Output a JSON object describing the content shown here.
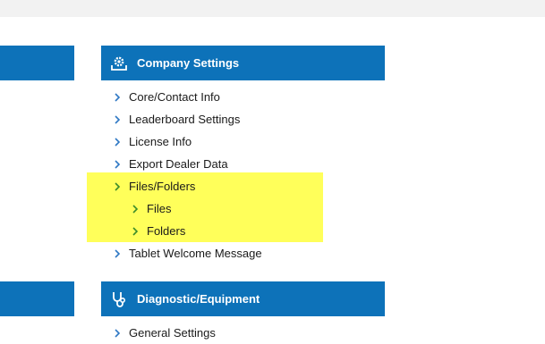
{
  "colors": {
    "header_bg": "#0d72b9",
    "highlight": "#ffff5a",
    "chevron_default": "#2f78c4",
    "chevron_highlighted": "#3c8c2a",
    "topbar": "#f2f2f2"
  },
  "company_settings": {
    "title": "Company Settings",
    "icon": "gear-upload-icon",
    "items": [
      {
        "label": "Core/Contact Info"
      },
      {
        "label": "Leaderboard Settings"
      },
      {
        "label": "License Info"
      },
      {
        "label": "Export Dealer Data"
      },
      {
        "label": "Files/Folders",
        "highlighted": true
      },
      {
        "label": "Files",
        "highlighted": true,
        "indent": true
      },
      {
        "label": "Folders",
        "highlighted": true,
        "indent": true
      },
      {
        "label": "Tablet Welcome Message"
      }
    ]
  },
  "diagnostic_equipment": {
    "title": "Diagnostic/Equipment",
    "icon": "stethoscope-icon",
    "items": [
      {
        "label": "General Settings"
      }
    ]
  }
}
